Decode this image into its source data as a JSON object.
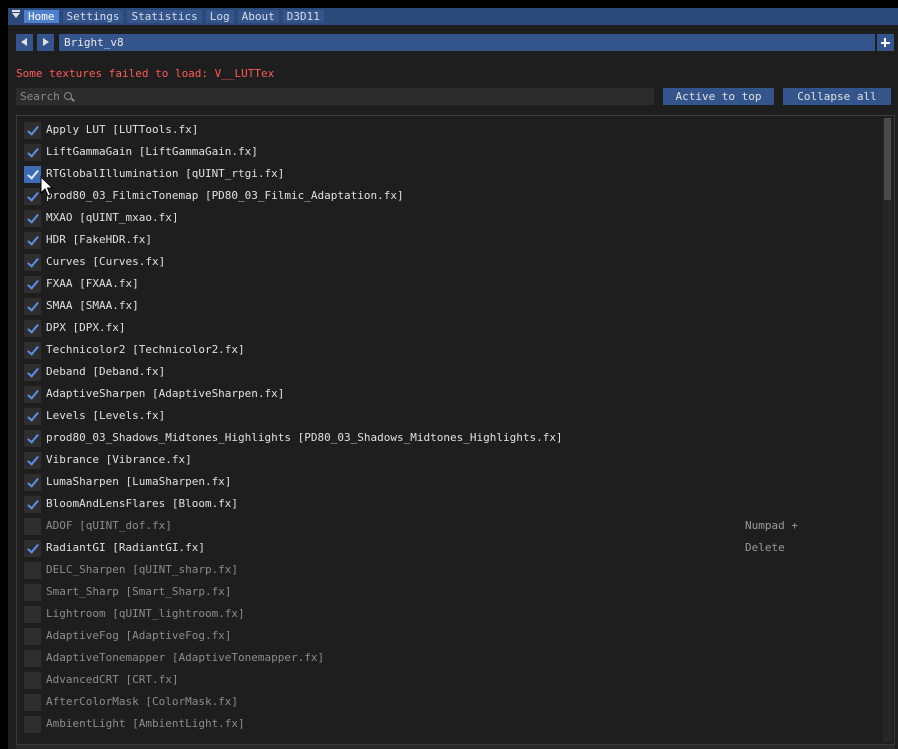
{
  "tabs": [
    "Home",
    "Settings",
    "Statistics",
    "Log",
    "About",
    "D3D11"
  ],
  "active_tab": "Home",
  "preset": {
    "name": "Bright_v8"
  },
  "error_message": "Some textures failed to load: V__LUTTex",
  "search": {
    "placeholder": "Search"
  },
  "buttons": {
    "active_to_top": "Active to top",
    "collapse_all": "Collapse all"
  },
  "colors": {
    "accent": "#34558b",
    "active_tab": "#4f7fd0",
    "checkmark": "#5e8fe6",
    "error": "#ff5a5a",
    "background": "#1e1e1e"
  },
  "effects": [
    {
      "label": "Apply LUT [LUTTools.fx]",
      "enabled": true,
      "key": ""
    },
    {
      "label": "LiftGammaGain [LiftGammaGain.fx]",
      "enabled": true,
      "key": ""
    },
    {
      "label": "RTGlobalIllumination [qUINT_rtgi.fx]",
      "enabled": true,
      "key": "",
      "hover": true
    },
    {
      "label": "prod80_03_FilmicTonemap [PD80_03_Filmic_Adaptation.fx]",
      "enabled": true,
      "key": ""
    },
    {
      "label": "MXAO [qUINT_mxao.fx]",
      "enabled": true,
      "key": ""
    },
    {
      "label": "HDR [FakeHDR.fx]",
      "enabled": true,
      "key": ""
    },
    {
      "label": "Curves [Curves.fx]",
      "enabled": true,
      "key": ""
    },
    {
      "label": "FXAA [FXAA.fx]",
      "enabled": true,
      "key": ""
    },
    {
      "label": "SMAA [SMAA.fx]",
      "enabled": true,
      "key": ""
    },
    {
      "label": "DPX [DPX.fx]",
      "enabled": true,
      "key": ""
    },
    {
      "label": "Technicolor2 [Technicolor2.fx]",
      "enabled": true,
      "key": ""
    },
    {
      "label": "Deband [Deband.fx]",
      "enabled": true,
      "key": ""
    },
    {
      "label": "AdaptiveSharpen [AdaptiveSharpen.fx]",
      "enabled": true,
      "key": ""
    },
    {
      "label": "Levels [Levels.fx]",
      "enabled": true,
      "key": ""
    },
    {
      "label": "prod80_03_Shadows_Midtones_Highlights [PD80_03_Shadows_Midtones_Highlights.fx]",
      "enabled": true,
      "key": ""
    },
    {
      "label": "Vibrance [Vibrance.fx]",
      "enabled": true,
      "key": ""
    },
    {
      "label": "LumaSharpen [LumaSharpen.fx]",
      "enabled": true,
      "key": ""
    },
    {
      "label": "BloomAndLensFlares [Bloom.fx]",
      "enabled": true,
      "key": ""
    },
    {
      "label": "ADOF [qUINT_dof.fx]",
      "enabled": false,
      "key": "Numpad +"
    },
    {
      "label": "RadiantGI [RadiantGI.fx]",
      "enabled": true,
      "key": "Delete"
    },
    {
      "label": "DELC_Sharpen [qUINT_sharp.fx]",
      "enabled": false,
      "key": ""
    },
    {
      "label": "Smart_Sharp [Smart_Sharp.fx]",
      "enabled": false,
      "key": ""
    },
    {
      "label": "Lightroom [qUINT_lightroom.fx]",
      "enabled": false,
      "key": ""
    },
    {
      "label": "AdaptiveFog [AdaptiveFog.fx]",
      "enabled": false,
      "key": ""
    },
    {
      "label": "AdaptiveTonemapper [AdaptiveTonemapper.fx]",
      "enabled": false,
      "key": ""
    },
    {
      "label": "AdvancedCRT [CRT.fx]",
      "enabled": false,
      "key": ""
    },
    {
      "label": "AfterColorMask [ColorMask.fx]",
      "enabled": false,
      "key": ""
    },
    {
      "label": "AmbientLight [AmbientLight.fx]",
      "enabled": false,
      "key": ""
    }
  ]
}
